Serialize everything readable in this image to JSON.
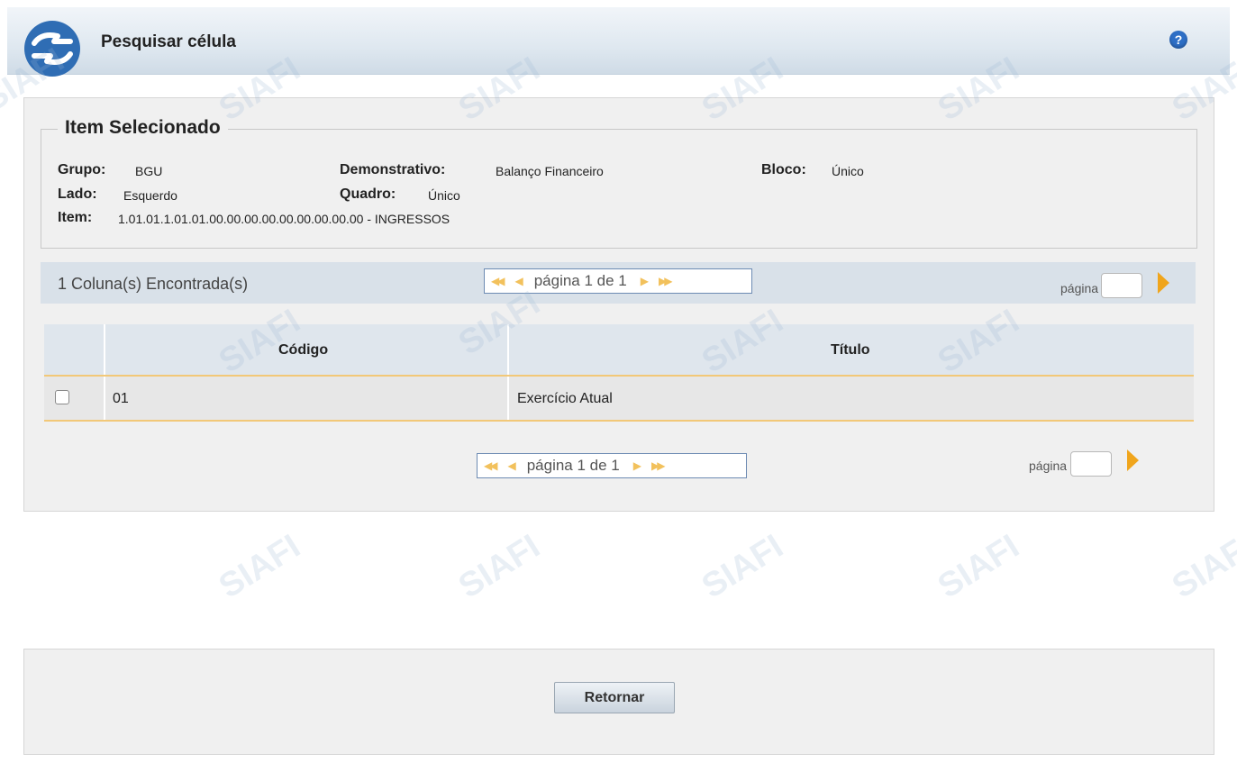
{
  "header": {
    "title": "Pesquisar célula",
    "help_icon": "?"
  },
  "item": {
    "legend": "Item Selecionado",
    "grupo_label": "Grupo:",
    "grupo_value": "BGU",
    "demonstrativo_label": "Demonstrativo:",
    "demonstrativo_value": "Balanço Financeiro",
    "bloco_label": "Bloco:",
    "bloco_value": "Único",
    "lado_label": "Lado:",
    "lado_value": "Esquerdo",
    "quadro_label": "Quadro:",
    "quadro_value": "Único",
    "item_label": "Item:",
    "item_value": "1.01.01.1.01.01.00.00.00.00.00.00.00.00.00 - INGRESSOS"
  },
  "results": {
    "found_text": "1 Coluna(s) Encontrada(s)",
    "pager_text": "página 1 de 1",
    "page_label": "página",
    "page_input_value": ""
  },
  "table": {
    "headers": [
      "Código",
      "Título"
    ],
    "rows": [
      {
        "codigo": "01",
        "titulo": "Exercício Atual"
      }
    ]
  },
  "footer": {
    "return_button": "Retornar"
  },
  "watermark": "SIAFI",
  "colors": {
    "accent": "#f0a51c",
    "header_bg": "#dfe8f0",
    "brand": "#2f6db4"
  }
}
